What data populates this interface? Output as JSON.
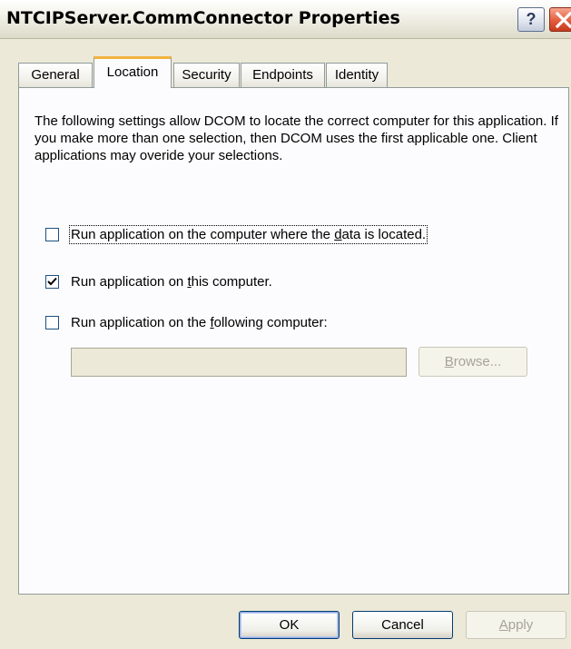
{
  "window": {
    "title": "NTCIPServer.CommConnector Properties",
    "help_label": "?",
    "close_icon": "close-icon"
  },
  "tabs": [
    {
      "label": "General",
      "active": false
    },
    {
      "label": "Location",
      "active": true
    },
    {
      "label": "Security",
      "active": false
    },
    {
      "label": "Endpoints",
      "active": false
    },
    {
      "label": "Identity",
      "active": false
    }
  ],
  "location": {
    "description": "The following settings allow DCOM to locate the correct computer for this application. If you make more than one selection, then DCOM uses the first applicable one. Client applications may overide your selections.",
    "options": [
      {
        "label_pre": "Run application on the computer where the ",
        "label_mnemonic": "d",
        "label_post": "ata is located.",
        "checked": false
      },
      {
        "label_pre": "Run application on ",
        "label_mnemonic": "t",
        "label_post": "his computer.",
        "checked": true
      },
      {
        "label_pre": "Run application on the ",
        "label_mnemonic": "f",
        "label_post": "ollowing computer:",
        "checked": false
      }
    ],
    "computer_value": "",
    "browse": {
      "mnemonic": "B",
      "rest": "rowse..."
    }
  },
  "buttons": {
    "ok": "OK",
    "cancel": "Cancel",
    "apply_mnemonic": "A",
    "apply_rest": "pply"
  },
  "colors": {
    "accent_tab": "#f2b33d",
    "dialog_bg": "#ece9d8",
    "close_red": "#e45e3e"
  }
}
